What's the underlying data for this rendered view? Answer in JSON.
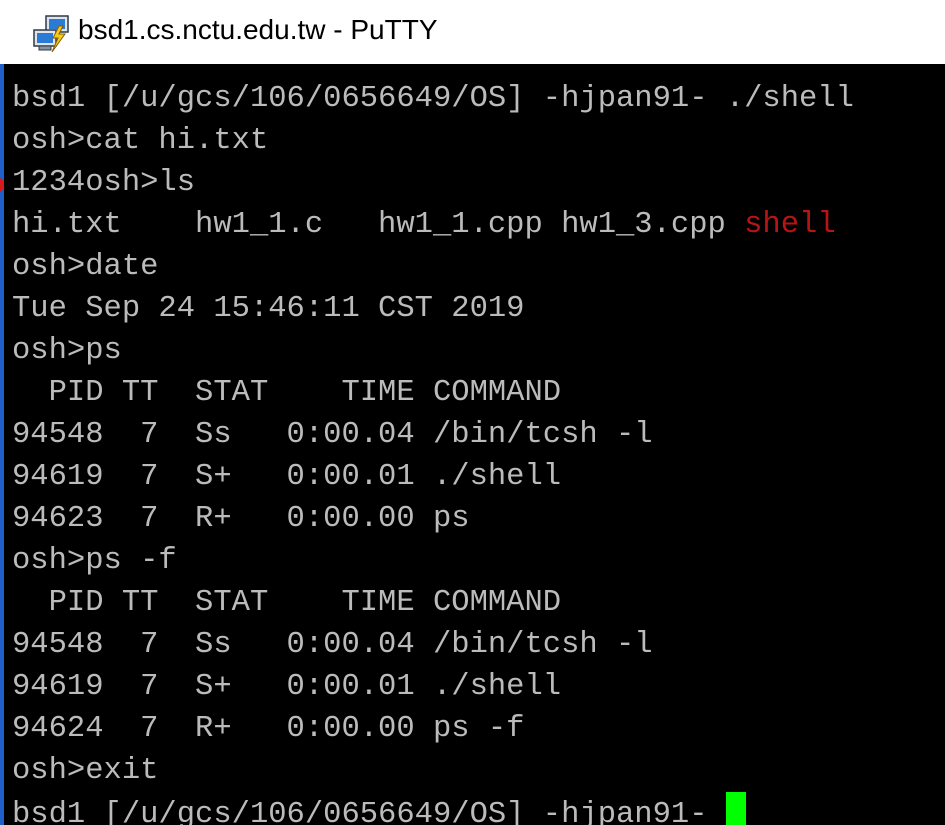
{
  "window": {
    "title": "bsd1.cs.nctu.edu.tw - PuTTY",
    "icon": "putty-icon"
  },
  "colors": {
    "terminal_background": "#000000",
    "terminal_text": "#bbbbbb",
    "executable_highlight": "#b81414",
    "cursor": "#00ff00"
  },
  "terminal": {
    "lines": [
      "bsd1 [/u/gcs/106/0656649/OS] -hjpan91- ./shell",
      "osh>cat hi.txt",
      "1234osh>ls",
      "hi.txt    hw1_1.c   hw1_1.cpp hw1_3.cpp ",
      "osh>date",
      "Tue Sep 24 15:46:11 CST 2019",
      "osh>ps",
      "  PID TT  STAT    TIME COMMAND",
      "94548  7  Ss   0:00.04 /bin/tcsh -l",
      "94619  7  S+   0:00.01 ./shell",
      "94623  7  R+   0:00.00 ps",
      "osh>ps -f",
      "  PID TT  STAT    TIME COMMAND",
      "94548  7  Ss   0:00.04 /bin/tcsh -l",
      "94619  7  S+   0:00.01 ./shell",
      "94624  7  R+   0:00.00 ps -f",
      "osh>exit",
      "bsd1 [/u/gcs/106/0656649/OS] -hjpan91- "
    ],
    "ls_executable": "shell"
  }
}
